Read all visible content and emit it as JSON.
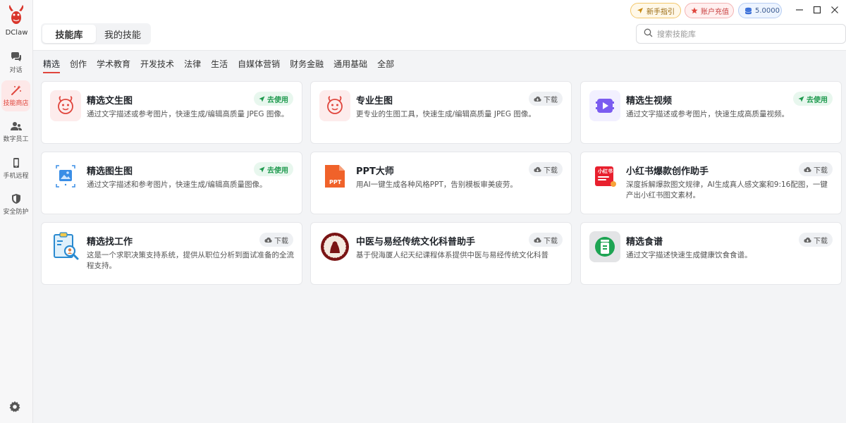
{
  "app": {
    "name": "DClaw"
  },
  "sidebar": {
    "items": [
      {
        "label": "对话",
        "icon": "chat-icon"
      },
      {
        "label": "技能商店",
        "icon": "magic-wand-icon",
        "active": true
      },
      {
        "label": "数字员工",
        "icon": "users-icon"
      },
      {
        "label": "手机远程",
        "icon": "phone-icon"
      },
      {
        "label": "安全防护",
        "icon": "shield-icon"
      }
    ],
    "settings_icon": "gear-icon"
  },
  "header": {
    "tabs": [
      {
        "label": "技能库",
        "active": true
      },
      {
        "label": "我的技能",
        "active": false
      }
    ],
    "guide_label": "新手指引",
    "recharge_label": "账户充值",
    "balance": "5.0000",
    "search": {
      "placeholder": "搜索技能库"
    }
  },
  "categories": [
    "精选",
    "创作",
    "学术教育",
    "开发技术",
    "法律",
    "生活",
    "自媒体营销",
    "财务金融",
    "通用基础",
    "全部"
  ],
  "active_category": "精选",
  "cards": [
    {
      "title": "精选文生图",
      "desc": "通过文字描述或参考图片，快速生成/编辑高质量 JPEG 图像。",
      "action": "去使用",
      "action_type": "use",
      "icon": "lobster-icon"
    },
    {
      "title": "专业生图",
      "desc": "更专业的生图工具，快速生成/编辑高质量 JPEG 图像。",
      "action": "下载",
      "action_type": "download",
      "icon": "lobster-icon"
    },
    {
      "title": "精选生视频",
      "desc": "通过文字描述或参考图片，快速生成高质量视频。",
      "action": "去使用",
      "action_type": "use",
      "icon": "video-icon"
    },
    {
      "title": "精选图生图",
      "desc": "通过文字描述和参考图片，快速生成/编辑高质量图像。",
      "action": "去使用",
      "action_type": "use",
      "icon": "image-edit-icon"
    },
    {
      "title": "PPT大师",
      "desc": "用AI一键生成各种风格PPT，告别模板审美疲劳。",
      "action": "下载",
      "action_type": "download",
      "icon": "ppt-icon",
      "icon_text": "PPT"
    },
    {
      "title": "小红书爆款创作助手",
      "desc": "深度拆解爆款图文规律，AI生成真人感文案和9:16配图，一键产出小红书图文素材。",
      "action": "下载",
      "action_type": "download",
      "icon": "xiaohongshu-icon",
      "icon_text": "小红书"
    },
    {
      "title": "精选找工作",
      "desc": "这是一个求职决策支持系统，提供从职位分析到面试准备的全流程支持。",
      "action": "下载",
      "action_type": "download",
      "icon": "job-search-icon"
    },
    {
      "title": "中医与易经传统文化科普助手",
      "desc": "基于倪海厦人纪天纪课程体系提供中医与易经传统文化科普",
      "action": "下载",
      "action_type": "download",
      "icon": "tcm-seal-icon"
    },
    {
      "title": "精选食谱",
      "desc": "通过文字描述快速生成健康饮食食谱。",
      "action": "下载",
      "action_type": "download",
      "icon": "recipe-icon"
    }
  ],
  "colors": {
    "accent": "#e0463d",
    "use_green": "#1e9a4e",
    "video_purple": "#7b5cf0"
  }
}
